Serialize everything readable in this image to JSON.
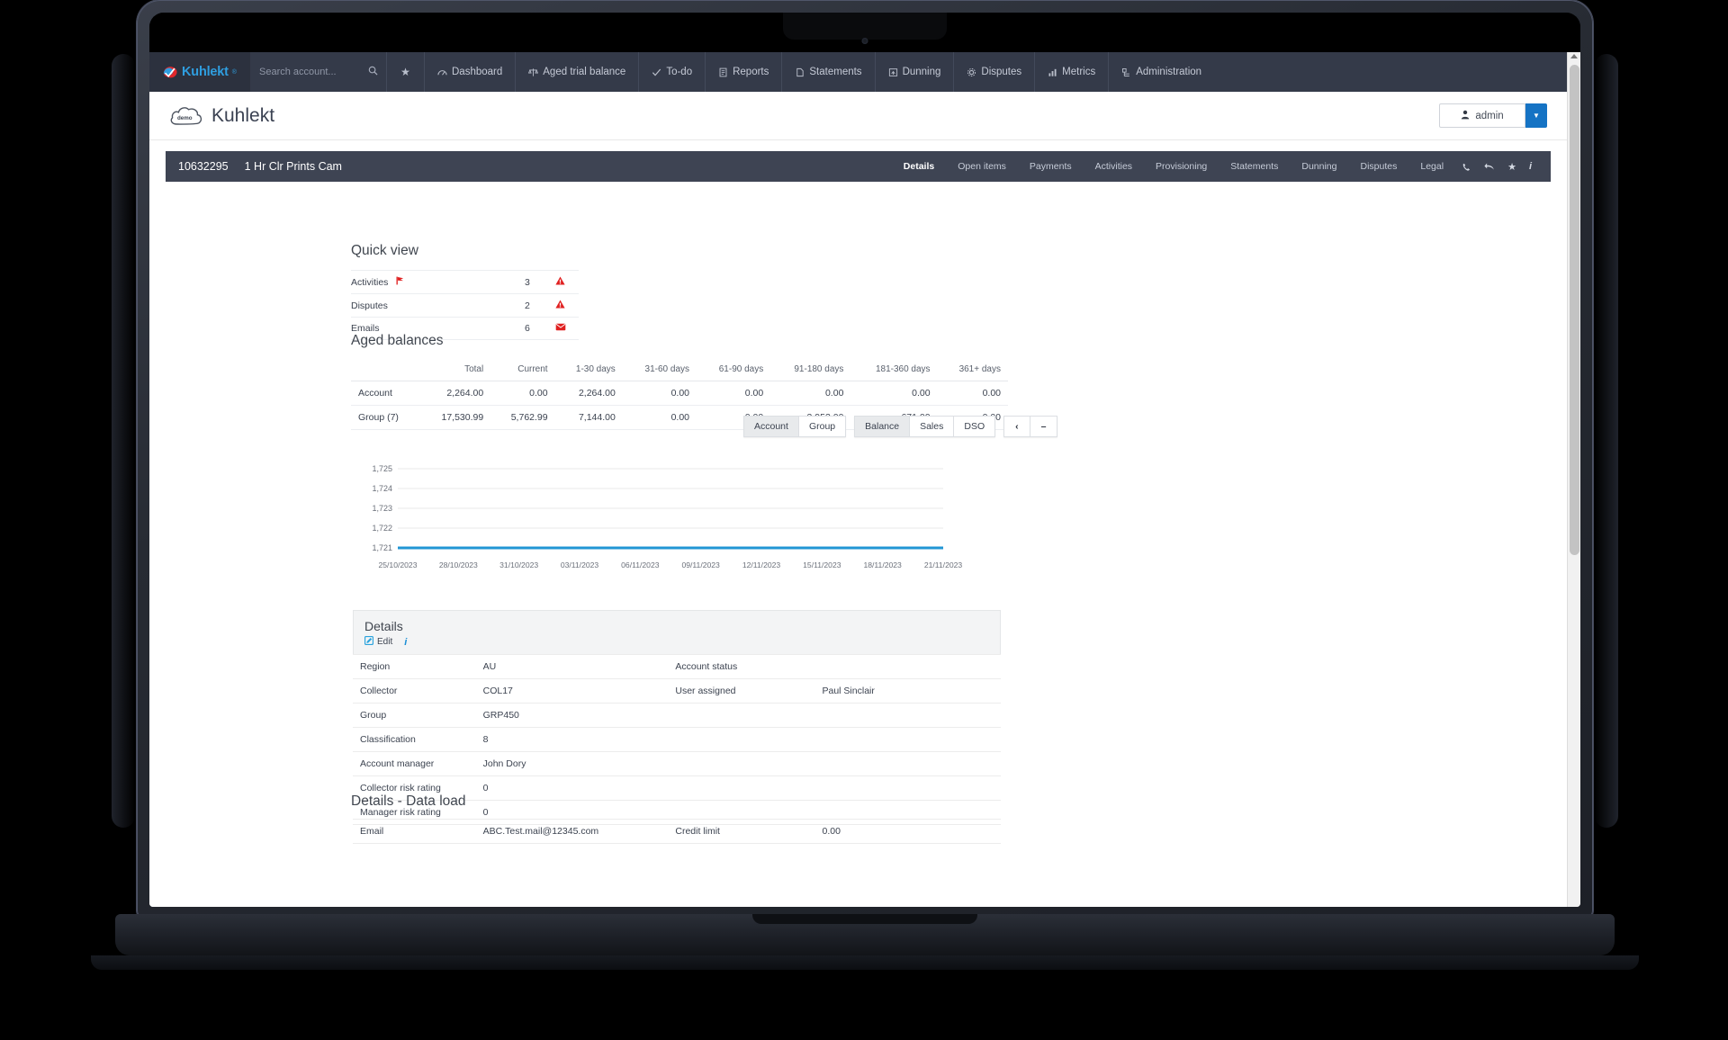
{
  "colors": {
    "nav_bg": "#343a49",
    "brand_blue": "#2f9ee0",
    "accent_blue": "#1573c4",
    "acct_bar": "#3e4453",
    "alert_red": "#e02020",
    "chart_line": "#2196d4"
  },
  "topnav": {
    "brand": "Kuhlekt",
    "brand_tm": "®",
    "search": {
      "placeholder": "Search account...",
      "value": "",
      "icon": "search-icon"
    },
    "star_icon": "star-icon",
    "items": [
      {
        "label": "Dashboard",
        "icon": "gauge-icon"
      },
      {
        "label": "Aged trial balance",
        "icon": "balance-icon"
      },
      {
        "label": "To-do",
        "icon": "check-icon"
      },
      {
        "label": "Reports",
        "icon": "report-icon"
      },
      {
        "label": "Statements",
        "icon": "statement-icon"
      },
      {
        "label": "Dunning",
        "icon": "dunning-icon"
      },
      {
        "label": "Disputes",
        "icon": "gear-icon"
      },
      {
        "label": "Metrics",
        "icon": "bar-chart-icon"
      },
      {
        "label": "Administration",
        "icon": "admin-icon"
      }
    ]
  },
  "pagehead": {
    "logo_text": "demo",
    "title": "Kuhlekt",
    "user_button": "admin",
    "user_icon": "person-icon",
    "caret_icon": "chevron-down-icon"
  },
  "account": {
    "number": "10632295",
    "name": "1 Hr Clr Prints Cam",
    "tabs": [
      {
        "label": "Details",
        "active": true
      },
      {
        "label": "Open items",
        "active": false
      },
      {
        "label": "Payments",
        "active": false
      },
      {
        "label": "Activities",
        "active": false
      },
      {
        "label": "Provisioning",
        "active": false
      },
      {
        "label": "Statements",
        "active": false
      },
      {
        "label": "Dunning",
        "active": false
      },
      {
        "label": "Disputes",
        "active": false
      },
      {
        "label": "Legal",
        "active": false
      }
    ],
    "icons": [
      "phone-icon",
      "undo-icon",
      "star-icon",
      "info-icon"
    ]
  },
  "quick_view": {
    "title": "Quick view",
    "rows": [
      {
        "label": "Activities",
        "label_icon": "flag-icon",
        "value": "3",
        "status_icon": "warning-icon"
      },
      {
        "label": "Disputes",
        "label_icon": "",
        "value": "2",
        "status_icon": "warning-icon"
      },
      {
        "label": "Emails",
        "label_icon": "",
        "value": "6",
        "status_icon": "envelope-icon"
      }
    ]
  },
  "aged_balances": {
    "title": "Aged balances",
    "columns": [
      "",
      "Total",
      "Current",
      "1-30 days",
      "31-60 days",
      "61-90 days",
      "91-180 days",
      "181-360 days",
      "361+ days"
    ],
    "rows": [
      {
        "cells": [
          "Account",
          "2,264.00",
          "0.00",
          "2,264.00",
          "0.00",
          "0.00",
          "0.00",
          "0.00",
          "0.00"
        ]
      },
      {
        "cells": [
          "Group (7)",
          "17,530.99",
          "5,762.99",
          "7,144.00",
          "0.00",
          "0.00",
          "3,953.00",
          "671.00",
          "0.00"
        ]
      }
    ]
  },
  "chart_controls": {
    "scope": [
      {
        "label": "Account",
        "active": true
      },
      {
        "label": "Group",
        "active": false
      }
    ],
    "metric": [
      {
        "label": "Balance",
        "active": true
      },
      {
        "label": "Sales",
        "active": false
      },
      {
        "label": "DSO",
        "active": false
      }
    ],
    "nav": [
      {
        "label": "‹",
        "icon": "chevron-left-icon"
      },
      {
        "label": "–",
        "icon": "minus-icon"
      }
    ]
  },
  "chart_data": {
    "type": "line",
    "title": "",
    "xlabel": "",
    "ylabel": "",
    "grid": true,
    "legend": false,
    "ylim": [
      1721,
      1725
    ],
    "yticks": [
      "1,721",
      "1,722",
      "1,723",
      "1,724",
      "1,725"
    ],
    "x": [
      "25/10/2023",
      "28/10/2023",
      "31/10/2023",
      "03/11/2023",
      "06/11/2023",
      "09/11/2023",
      "12/11/2023",
      "15/11/2023",
      "18/11/2023",
      "21/11/2023"
    ],
    "series": [
      {
        "name": "Balance",
        "color": "#2196d4",
        "values": [
          1721,
          1721,
          1721,
          1721,
          1721,
          1721,
          1721,
          1721,
          1721,
          1721
        ]
      }
    ]
  },
  "details": {
    "title": "Details",
    "edit_label": "Edit",
    "edit_icon": "edit-icon",
    "info_icon": "info-icon",
    "rows": [
      {
        "k1": "Region",
        "v1": "AU",
        "k2": "Account status",
        "v2": ""
      },
      {
        "k1": "Collector",
        "v1": "COL17",
        "k2": "User assigned",
        "v2": "Paul Sinclair"
      },
      {
        "k1": "Group",
        "v1": "GRP450",
        "k2": "",
        "v2": ""
      },
      {
        "k1": "Classification",
        "v1": "8",
        "k2": "",
        "v2": ""
      },
      {
        "k1": "Account manager",
        "v1": "John Dory",
        "k2": "",
        "v2": ""
      },
      {
        "k1": "Collector risk rating",
        "v1": "0",
        "k2": "",
        "v2": ""
      },
      {
        "k1": "Manager risk rating",
        "v1": "0",
        "k2": "",
        "v2": ""
      }
    ]
  },
  "data_load": {
    "title": "Details - Data load",
    "rows": [
      {
        "k1": "Email",
        "v1": "ABC.Test.mail@12345.com",
        "k2": "Credit limit",
        "v2": "0.00"
      }
    ]
  }
}
